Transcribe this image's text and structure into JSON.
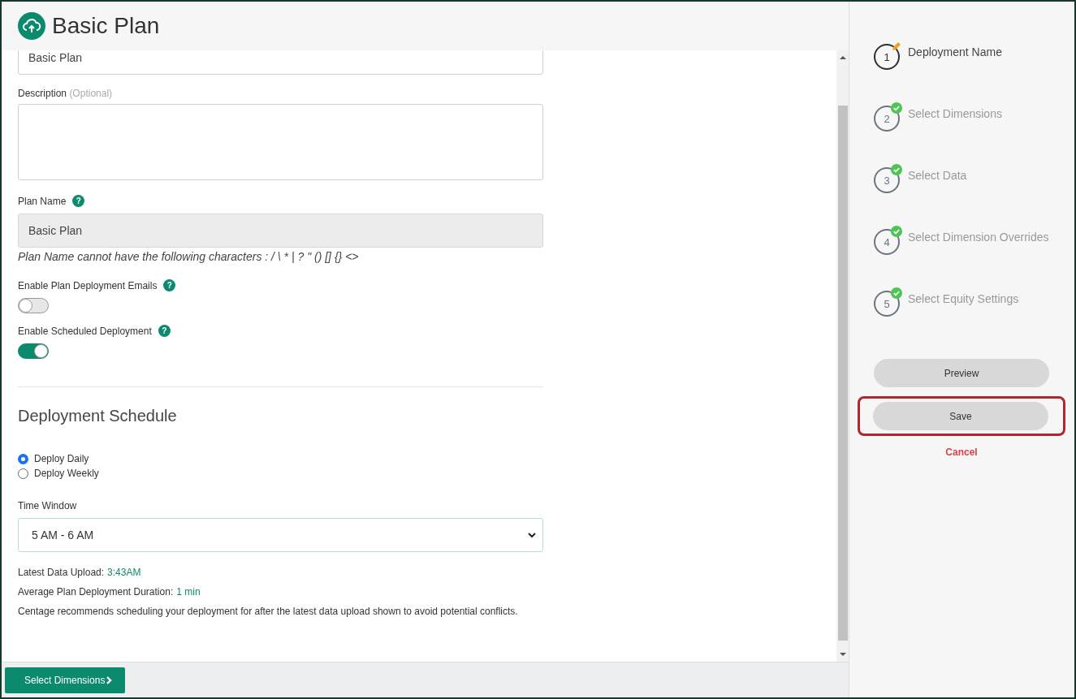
{
  "header": {
    "title": "Basic Plan"
  },
  "form": {
    "name_value": "Basic Plan",
    "description": {
      "label": "Description",
      "optional": "(Optional)"
    },
    "plan_name": {
      "label": "Plan Name",
      "help": "?",
      "value": "Basic Plan",
      "disabled": true,
      "note": "Plan Name cannot have the following characters : / \\ * | ? \" () [] {} <>"
    },
    "toggles": [
      {
        "label": "Enable Plan Deployment Emails",
        "help": "?",
        "on": false
      },
      {
        "label": "Enable Scheduled Deployment",
        "help": "?",
        "on": true
      }
    ],
    "section_title": "Deployment Schedule",
    "radios": [
      {
        "label": "Deploy Daily",
        "selected": true
      },
      {
        "label": "Deploy Weekly",
        "selected": false
      }
    ],
    "time_window": {
      "label": "Time Window",
      "value": "5 AM - 6 AM"
    },
    "info": [
      {
        "label": "Latest Data Upload:",
        "value": "3:43AM"
      },
      {
        "label": "Average Plan Deployment Duration:",
        "value": "1 min"
      }
    ],
    "recommendation": "Centage recommends scheduling your deployment for after the latest data upload shown to avoid potential conflicts."
  },
  "footer": {
    "next_button": "Select Dimensions"
  },
  "steps": [
    {
      "number": "1",
      "label": "Deployment Name",
      "selected": true,
      "completed": false
    },
    {
      "number": "2",
      "label": "Select Dimensions",
      "selected": false,
      "completed": true
    },
    {
      "number": "3",
      "label": "Select Data",
      "selected": false,
      "completed": true
    },
    {
      "number": "4",
      "label": "Select Dimension Overrides",
      "selected": false,
      "completed": true
    },
    {
      "number": "5",
      "label": "Select Equity Settings",
      "selected": false,
      "completed": true
    }
  ],
  "actions": [
    {
      "label": "Preview",
      "kind": "button",
      "highlighted": false
    },
    {
      "label": "Save",
      "kind": "button",
      "highlighted": true
    },
    {
      "label": "Cancel",
      "kind": "link",
      "highlighted": false
    }
  ]
}
